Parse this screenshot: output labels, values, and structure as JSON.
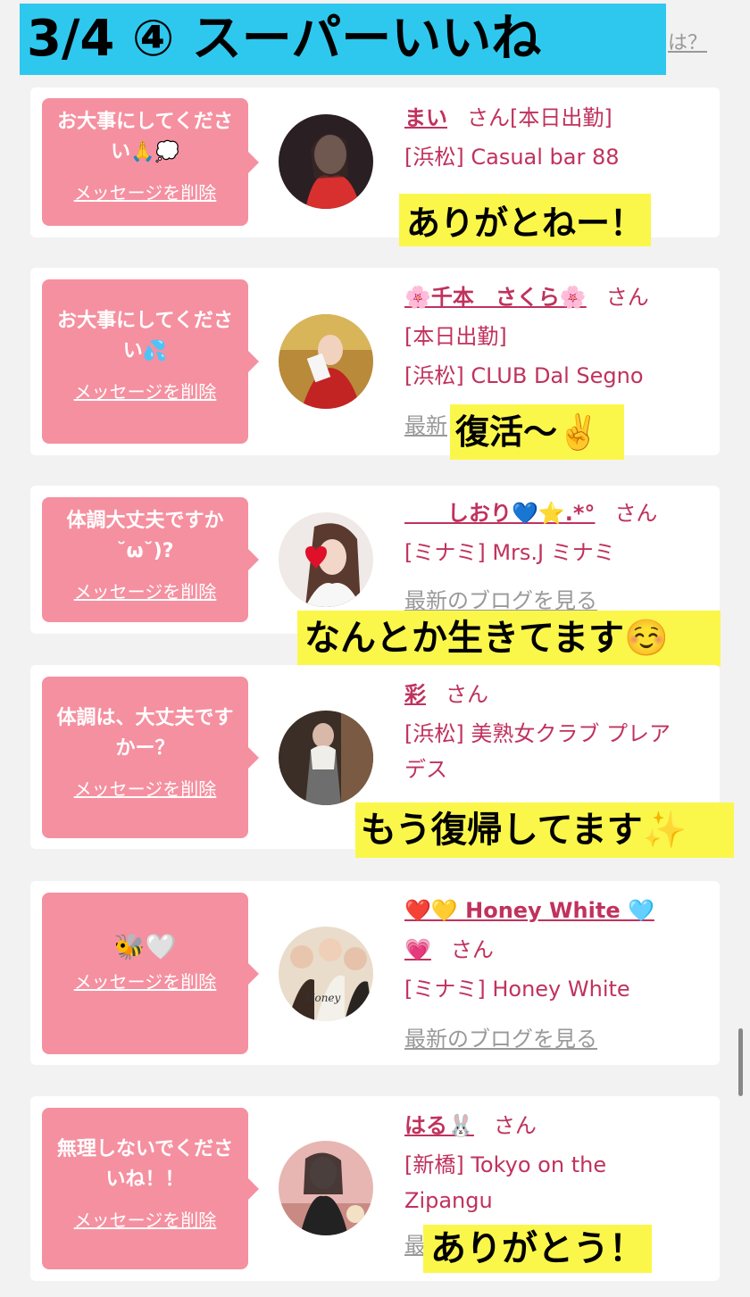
{
  "banner": {
    "title": "3/4 ④ スーパーいいね",
    "after": "は？"
  },
  "delete_label": "メッセージを削除",
  "cards": [
    {
      "message": "お大事にしてください🙏💭",
      "name": "まい",
      "san": "さん",
      "lines": [
        "[本日出勤]",
        "[浜松] Casual bar 88"
      ],
      "blog": "",
      "note": "ありがとねー！"
    },
    {
      "message": "お大事にしてください💦",
      "name": "🌸千本　さくら🌸",
      "san": "さん",
      "lines": [
        "[本日出勤]",
        "[浜松] CLUB Dal Segno"
      ],
      "blog": "最新",
      "note": "復活〜✌️"
    },
    {
      "message": "体調大丈夫ですか˘ω˘)?",
      "name": "　　しおり💙⭐.*°",
      "san": "さん",
      "lines": [
        "[ミナミ] Mrs.J ミナミ"
      ],
      "blog": "最新のブログを見る",
      "note": "なんとか生きてます☺️"
    },
    {
      "message": "体調は、大丈夫ですかー？",
      "name": "彩",
      "san": "さん",
      "lines": [
        "[浜松] 美熟女クラブ プレア",
        "デス"
      ],
      "blog": "",
      "note": "もう復帰してます✨"
    },
    {
      "message": "🐝🤍",
      "name": "❤️💛 Honey White 🩵",
      "name2": "💗",
      "san": "さん",
      "lines": [
        "[ミナミ] Honey White"
      ],
      "blog": "最新のブログを見る",
      "note": ""
    },
    {
      "message": "無理しないでくださいね！！",
      "name": "はる🐰",
      "san": "さん",
      "lines": [
        "[新橋] Tokyo on the",
        "Zipangu"
      ],
      "blog": "最",
      "note": "ありがとう！"
    }
  ],
  "colors": {
    "banner": "#2ec8ee",
    "message_bg": "#f590a0",
    "name": "#c0325e",
    "highlight": "#fbf74a"
  }
}
